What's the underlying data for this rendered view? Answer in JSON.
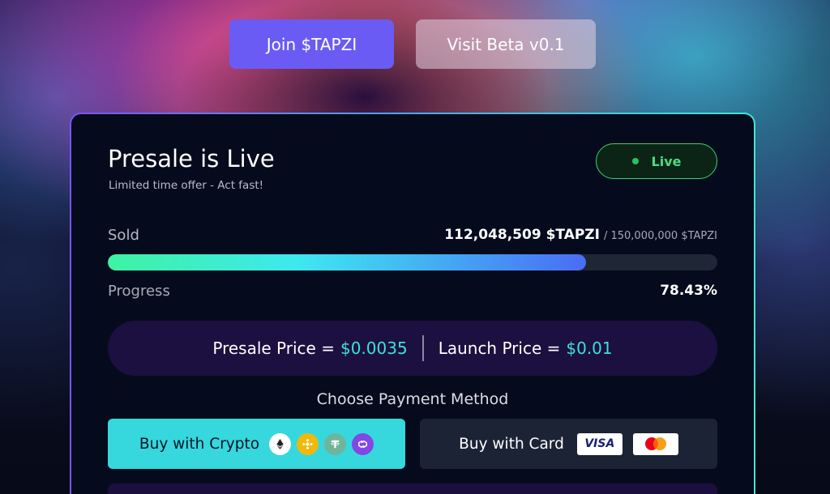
{
  "header": {
    "join_label": "Join $TAPZI",
    "beta_label": "Visit Beta v0.1"
  },
  "presale": {
    "title": "Presale is Live",
    "subtitle": "Limited time offer - Act fast!",
    "badge": "Live",
    "sold_label": "Sold",
    "sold_amount": "112,048,509 $TAPZI",
    "sold_total": "/ 150,000,000 $TAPZI",
    "progress_label": "Progress",
    "progress_pct": "78.43%",
    "progress_fraction": 0.7843,
    "presale_price_label": "Presale Price =",
    "presale_price_value": "$0.0035",
    "launch_price_label": "Launch Price =",
    "launch_price_value": "$0.01",
    "choose_title": "Choose Payment Method",
    "buy_crypto_label": "Buy with Crypto",
    "buy_card_label": "Buy with Card",
    "crypto_icons": [
      "ethereum-icon",
      "bnb-icon",
      "tether-icon",
      "polygon-icon"
    ],
    "card_icons": [
      "visa-icon",
      "mastercard-icon"
    ],
    "visa_text": "VISA"
  },
  "colors": {
    "accent_purple": "#6a5bf5",
    "accent_teal": "#37d7de",
    "live_green": "#4ade80",
    "price_highlight": "#3fe0d8"
  }
}
